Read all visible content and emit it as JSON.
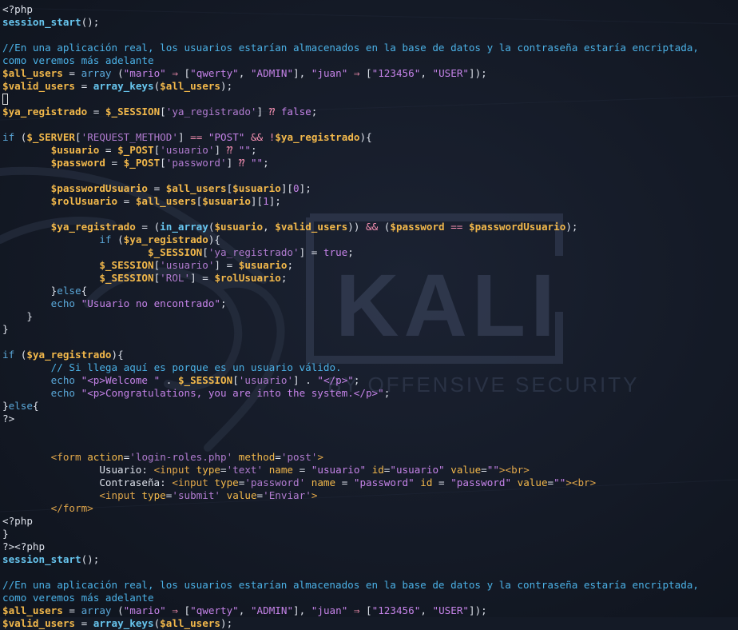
{
  "watermark": {
    "logo_text": "KALI",
    "tagline": "BY OFFENSIVE SECURITY"
  },
  "colors": {
    "background": "#141a26",
    "variable": "#f2b84b",
    "function": "#67c5ee",
    "keyword": "#5aa7d8",
    "string": "#c583e8",
    "operator": "#f48fb1",
    "comment": "#4bb1e6",
    "plain": "#dde1ea"
  },
  "editor": {
    "lines": [
      [
        [
          "plain",
          "<?php"
        ]
      ],
      [
        [
          "func",
          "session_start"
        ],
        [
          "plain",
          "();"
        ]
      ],
      [],
      [
        [
          "cmt",
          "//En una aplicación real, los usuarios estarían almacenados en la base de datos y la contraseña estaría encriptada,"
        ]
      ],
      [
        [
          "cmt",
          "como veremos más adelante"
        ]
      ],
      [
        [
          "var",
          "$all_users"
        ],
        [
          "plain",
          " = "
        ],
        [
          "kw",
          "array"
        ],
        [
          "plain",
          " ("
        ],
        [
          "str",
          "\"mario\""
        ],
        [
          "plain",
          " "
        ],
        [
          "op",
          "⇒"
        ],
        [
          "plain",
          " ["
        ],
        [
          "str",
          "\"qwerty\""
        ],
        [
          "plain",
          ", "
        ],
        [
          "str",
          "\"ADMIN\""
        ],
        [
          "plain",
          "], "
        ],
        [
          "str",
          "\"juan\""
        ],
        [
          "plain",
          " "
        ],
        [
          "op",
          "⇒"
        ],
        [
          "plain",
          " ["
        ],
        [
          "str",
          "\"123456\""
        ],
        [
          "plain",
          ", "
        ],
        [
          "str",
          "\"USER\""
        ],
        [
          "plain",
          "]);"
        ]
      ],
      [
        [
          "var",
          "$valid_users"
        ],
        [
          "plain",
          " = "
        ],
        [
          "func",
          "array_keys"
        ],
        [
          "plain",
          "("
        ],
        [
          "var",
          "$all_users"
        ],
        [
          "plain",
          "); "
        ]
      ],
      [
        [
          "cursor",
          ""
        ]
      ],
      [
        [
          "var",
          "$ya_registrado"
        ],
        [
          "plain",
          " = "
        ],
        [
          "var",
          "$_SESSION"
        ],
        [
          "plain",
          "["
        ],
        [
          "sq",
          "'ya_registrado'"
        ],
        [
          "plain",
          "] "
        ],
        [
          "op",
          "⁇"
        ],
        [
          "plain",
          " "
        ],
        [
          "bool",
          "false"
        ],
        [
          "plain",
          ";"
        ]
      ],
      [],
      [
        [
          "kw",
          "if"
        ],
        [
          "plain",
          " ("
        ],
        [
          "var",
          "$_SERVER"
        ],
        [
          "plain",
          "["
        ],
        [
          "sq",
          "'REQUEST_METHOD'"
        ],
        [
          "plain",
          "] "
        ],
        [
          "op",
          "=="
        ],
        [
          "plain",
          " "
        ],
        [
          "str",
          "\"POST\""
        ],
        [
          "plain",
          " "
        ],
        [
          "op",
          "&&"
        ],
        [
          "plain",
          " "
        ],
        [
          "op",
          "!"
        ],
        [
          "var",
          "$ya_registrado"
        ],
        [
          "plain",
          "){"
        ]
      ],
      [
        [
          "plain",
          "        "
        ],
        [
          "var",
          "$usuario"
        ],
        [
          "plain",
          " = "
        ],
        [
          "var",
          "$_POST"
        ],
        [
          "plain",
          "["
        ],
        [
          "sq",
          "'usuario'"
        ],
        [
          "plain",
          "] "
        ],
        [
          "op",
          "⁇"
        ],
        [
          "plain",
          " "
        ],
        [
          "str",
          "\"\""
        ],
        [
          "plain",
          ";"
        ]
      ],
      [
        [
          "plain",
          "        "
        ],
        [
          "var",
          "$password"
        ],
        [
          "plain",
          " = "
        ],
        [
          "var",
          "$_POST"
        ],
        [
          "plain",
          "["
        ],
        [
          "sq",
          "'password'"
        ],
        [
          "plain",
          "] "
        ],
        [
          "op",
          "⁇"
        ],
        [
          "plain",
          " "
        ],
        [
          "str",
          "\"\""
        ],
        [
          "plain",
          ";"
        ]
      ],
      [],
      [
        [
          "plain",
          "        "
        ],
        [
          "var",
          "$passwordUsuario"
        ],
        [
          "plain",
          " = "
        ],
        [
          "var",
          "$all_users"
        ],
        [
          "plain",
          "["
        ],
        [
          "var",
          "$usuario"
        ],
        [
          "plain",
          "]["
        ],
        [
          "num",
          "0"
        ],
        [
          "plain",
          "];"
        ]
      ],
      [
        [
          "plain",
          "        "
        ],
        [
          "var",
          "$rolUsuario"
        ],
        [
          "plain",
          " = "
        ],
        [
          "var",
          "$all_users"
        ],
        [
          "plain",
          "["
        ],
        [
          "var",
          "$usuario"
        ],
        [
          "plain",
          "]["
        ],
        [
          "num",
          "1"
        ],
        [
          "plain",
          "];"
        ]
      ],
      [],
      [
        [
          "plain",
          "        "
        ],
        [
          "var",
          "$ya_registrado"
        ],
        [
          "plain",
          " = ("
        ],
        [
          "func",
          "in_array"
        ],
        [
          "plain",
          "("
        ],
        [
          "var",
          "$usuario"
        ],
        [
          "plain",
          ", "
        ],
        [
          "var",
          "$valid_users"
        ],
        [
          "plain",
          ")) "
        ],
        [
          "op",
          "&&"
        ],
        [
          "plain",
          " ("
        ],
        [
          "var",
          "$password"
        ],
        [
          "plain",
          " "
        ],
        [
          "op",
          "=="
        ],
        [
          "plain",
          " "
        ],
        [
          "var",
          "$passwordUsuario"
        ],
        [
          "plain",
          ");"
        ]
      ],
      [
        [
          "plain",
          "                "
        ],
        [
          "kw",
          "if"
        ],
        [
          "plain",
          " ("
        ],
        [
          "var",
          "$ya_registrado"
        ],
        [
          "plain",
          "){"
        ]
      ],
      [
        [
          "plain",
          "                        "
        ],
        [
          "var",
          "$_SESSION"
        ],
        [
          "plain",
          "["
        ],
        [
          "sq",
          "'ya_registrado'"
        ],
        [
          "plain",
          "] = "
        ],
        [
          "bool",
          "true"
        ],
        [
          "plain",
          ";"
        ]
      ],
      [
        [
          "plain",
          "                "
        ],
        [
          "var",
          "$_SESSION"
        ],
        [
          "plain",
          "["
        ],
        [
          "sq",
          "'usuario'"
        ],
        [
          "plain",
          "] = "
        ],
        [
          "var",
          "$usuario"
        ],
        [
          "plain",
          ";"
        ]
      ],
      [
        [
          "plain",
          "                "
        ],
        [
          "var",
          "$_SESSION"
        ],
        [
          "plain",
          "["
        ],
        [
          "sq",
          "'ROL'"
        ],
        [
          "plain",
          "] = "
        ],
        [
          "var",
          "$rolUsuario"
        ],
        [
          "plain",
          ";"
        ]
      ],
      [
        [
          "plain",
          "        }"
        ],
        [
          "kw",
          "else"
        ],
        [
          "plain",
          "{"
        ]
      ],
      [
        [
          "plain",
          "        "
        ],
        [
          "kw",
          "echo"
        ],
        [
          "plain",
          " "
        ],
        [
          "str",
          "\"Usuario no encontrado\""
        ],
        [
          "plain",
          ";"
        ]
      ],
      [
        [
          "plain",
          "    }"
        ]
      ],
      [
        [
          "plain",
          "}"
        ]
      ],
      [],
      [
        [
          "kw",
          "if"
        ],
        [
          "plain",
          " ("
        ],
        [
          "var",
          "$ya_registrado"
        ],
        [
          "plain",
          "){"
        ]
      ],
      [
        [
          "plain",
          "        "
        ],
        [
          "cmt",
          "// Si llega aquí es porque es un usuario válido."
        ]
      ],
      [
        [
          "plain",
          "        "
        ],
        [
          "kw",
          "echo"
        ],
        [
          "plain",
          " "
        ],
        [
          "str",
          "\"<p>Welcome \""
        ],
        [
          "plain",
          " . "
        ],
        [
          "var",
          "$_SESSION"
        ],
        [
          "plain",
          "["
        ],
        [
          "sq",
          "'usuario'"
        ],
        [
          "plain",
          "] . "
        ],
        [
          "str",
          "\"</p>\""
        ],
        [
          "plain",
          ";"
        ]
      ],
      [
        [
          "plain",
          "        "
        ],
        [
          "kw",
          "echo"
        ],
        [
          "plain",
          " "
        ],
        [
          "str",
          "\"<p>Congratulations, you are into the system.</p>\""
        ],
        [
          "plain",
          ";"
        ]
      ],
      [
        [
          "plain",
          "}"
        ],
        [
          "kw",
          "else"
        ],
        [
          "plain",
          "{"
        ]
      ],
      [
        [
          "plain",
          "?>"
        ]
      ],
      [],
      [],
      [
        [
          "plain",
          "        "
        ],
        [
          "tag",
          "<form"
        ],
        [
          "plain",
          " "
        ],
        [
          "attr",
          "action"
        ],
        [
          "plain",
          "="
        ],
        [
          "sq",
          "'login-roles.php'"
        ],
        [
          "plain",
          " "
        ],
        [
          "attr",
          "method"
        ],
        [
          "plain",
          "="
        ],
        [
          "sq",
          "'post'"
        ],
        [
          "tag",
          ">"
        ]
      ],
      [
        [
          "plain",
          "                Usuario: "
        ],
        [
          "tag",
          "<input"
        ],
        [
          "plain",
          " "
        ],
        [
          "attr",
          "type"
        ],
        [
          "plain",
          "="
        ],
        [
          "sq",
          "'text'"
        ],
        [
          "plain",
          " "
        ],
        [
          "attr",
          "name"
        ],
        [
          "plain",
          " = "
        ],
        [
          "str",
          "\"usuario\""
        ],
        [
          "plain",
          " "
        ],
        [
          "attr",
          "id"
        ],
        [
          "plain",
          "="
        ],
        [
          "str",
          "\"usuario\""
        ],
        [
          "plain",
          " "
        ],
        [
          "attr",
          "value"
        ],
        [
          "plain",
          "="
        ],
        [
          "str",
          "\"\""
        ],
        [
          "tag",
          "><br>"
        ]
      ],
      [
        [
          "plain",
          "                Contraseña: "
        ],
        [
          "tag",
          "<input"
        ],
        [
          "plain",
          " "
        ],
        [
          "attr",
          "type"
        ],
        [
          "plain",
          "="
        ],
        [
          "sq",
          "'password'"
        ],
        [
          "plain",
          " "
        ],
        [
          "attr",
          "name"
        ],
        [
          "plain",
          " = "
        ],
        [
          "str",
          "\"password\""
        ],
        [
          "plain",
          " "
        ],
        [
          "attr",
          "id"
        ],
        [
          "plain",
          " = "
        ],
        [
          "str",
          "\"password\""
        ],
        [
          "plain",
          " "
        ],
        [
          "attr",
          "value"
        ],
        [
          "plain",
          "="
        ],
        [
          "str",
          "\"\""
        ],
        [
          "tag",
          "><br>"
        ]
      ],
      [
        [
          "plain",
          "                "
        ],
        [
          "tag",
          "<input"
        ],
        [
          "plain",
          " "
        ],
        [
          "attr",
          "type"
        ],
        [
          "plain",
          "="
        ],
        [
          "sq",
          "'submit'"
        ],
        [
          "plain",
          " "
        ],
        [
          "attr",
          "value"
        ],
        [
          "plain",
          "="
        ],
        [
          "sq",
          "'Enviar'"
        ],
        [
          "tag",
          ">"
        ]
      ],
      [
        [
          "plain",
          "        "
        ],
        [
          "tag",
          "</form>"
        ]
      ],
      [
        [
          "plain",
          "<?php"
        ]
      ],
      [
        [
          "plain",
          "}"
        ]
      ],
      [
        [
          "plain",
          "?><?php"
        ]
      ],
      [
        [
          "func",
          "session_start"
        ],
        [
          "plain",
          "();"
        ]
      ],
      [],
      [
        [
          "cmt",
          "//En una aplicación real, los usuarios estarían almacenados en la base de datos y la contraseña estaría encriptada,"
        ]
      ],
      [
        [
          "cmt",
          "como veremos más adelante"
        ]
      ],
      [
        [
          "var",
          "$all_users"
        ],
        [
          "plain",
          " = "
        ],
        [
          "kw",
          "array"
        ],
        [
          "plain",
          " ("
        ],
        [
          "str",
          "\"mario\""
        ],
        [
          "plain",
          " "
        ],
        [
          "op",
          "⇒"
        ],
        [
          "plain",
          " ["
        ],
        [
          "str",
          "\"qwerty\""
        ],
        [
          "plain",
          ", "
        ],
        [
          "str",
          "\"ADMIN\""
        ],
        [
          "plain",
          "], "
        ],
        [
          "str",
          "\"juan\""
        ],
        [
          "plain",
          " "
        ],
        [
          "op",
          "⇒"
        ],
        [
          "plain",
          " ["
        ],
        [
          "str",
          "\"123456\""
        ],
        [
          "plain",
          ", "
        ],
        [
          "str",
          "\"USER\""
        ],
        [
          "plain",
          "]);"
        ]
      ],
      [
        [
          "var",
          "$valid_users"
        ],
        [
          "plain",
          " = "
        ],
        [
          "func",
          "array_keys"
        ],
        [
          "plain",
          "("
        ],
        [
          "var",
          "$all_users"
        ],
        [
          "plain",
          ");"
        ]
      ]
    ]
  }
}
